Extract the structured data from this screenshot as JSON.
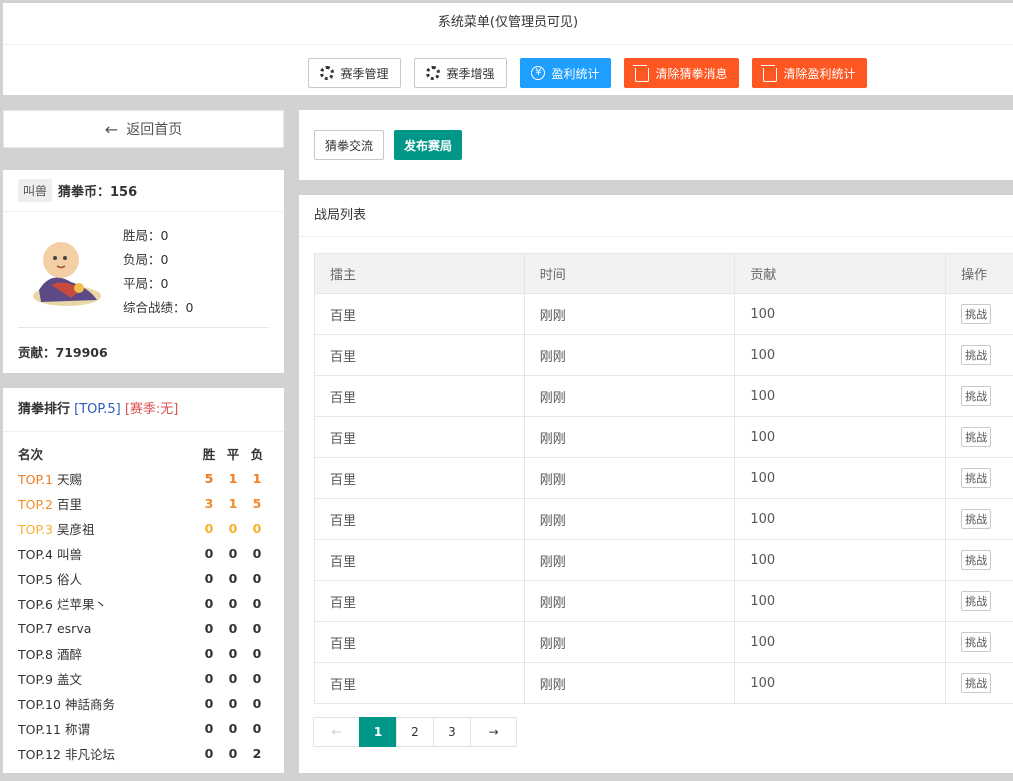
{
  "admin_menu": {
    "title": "系统菜单(仅管理员可见)",
    "buttons": [
      {
        "label": "赛季管理",
        "icon": "gear-icon"
      },
      {
        "label": "赛季增强",
        "icon": "gear-icon"
      },
      {
        "label": "盈利统计",
        "icon": "yen-icon"
      },
      {
        "label": "清除猜拳消息",
        "icon": "trash-icon"
      },
      {
        "label": "清除盈利统计",
        "icon": "trash-icon"
      }
    ]
  },
  "back_home": {
    "label": "返回首页",
    "icon": "arrow-left-icon"
  },
  "user": {
    "tag": "叫兽",
    "coin_label": "猜拳币：156",
    "wins": "胜局：0",
    "losses": "负局：0",
    "draws": "平局：0",
    "overall": "综合战绩：0",
    "contribution": "贡献：719906"
  },
  "ranking": {
    "title": "猜拳排行",
    "top_label": "[TOP.5]",
    "season_label": "[赛季:无]",
    "header": {
      "name": "名次",
      "win": "胜",
      "draw": "平",
      "loss": "负"
    },
    "rows": [
      {
        "rank": "TOP.1",
        "name": "天赐",
        "win": "5",
        "draw": "1",
        "loss": "1"
      },
      {
        "rank": "TOP.2",
        "name": "百里",
        "win": "3",
        "draw": "1",
        "loss": "5"
      },
      {
        "rank": "TOP.3",
        "name": "吴彦祖",
        "win": "0",
        "draw": "0",
        "loss": "0"
      },
      {
        "rank": "TOP.4",
        "name": "叫兽",
        "win": "0",
        "draw": "0",
        "loss": "0"
      },
      {
        "rank": "TOP.5",
        "name": "俗人",
        "win": "0",
        "draw": "0",
        "loss": "0"
      },
      {
        "rank": "TOP.6",
        "name": "烂苹果丶",
        "win": "0",
        "draw": "0",
        "loss": "0"
      },
      {
        "rank": "TOP.7",
        "name": "esrva",
        "win": "0",
        "draw": "0",
        "loss": "0"
      },
      {
        "rank": "TOP.8",
        "name": "酒醉",
        "win": "0",
        "draw": "0",
        "loss": "0"
      },
      {
        "rank": "TOP.9",
        "name": "盖文",
        "win": "0",
        "draw": "0",
        "loss": "0"
      },
      {
        "rank": "TOP.10",
        "name": "神話商务",
        "win": "0",
        "draw": "0",
        "loss": "0"
      },
      {
        "rank": "TOP.11",
        "name": "称谓",
        "win": "0",
        "draw": "0",
        "loss": "0"
      },
      {
        "rank": "TOP.12",
        "name": "非凡论坛",
        "win": "0",
        "draw": "0",
        "loss": "2"
      }
    ]
  },
  "actions": {
    "exchange_label": "猜拳交流",
    "publish_label": "发布赛局"
  },
  "battle_list": {
    "title": "战局列表",
    "columns": [
      "擂主",
      "时间",
      "贡献",
      "操作"
    ],
    "rows": [
      {
        "host": "百里",
        "time": "刚刚",
        "contrib": "100",
        "action": "挑战"
      },
      {
        "host": "百里",
        "time": "刚刚",
        "contrib": "100",
        "action": "挑战"
      },
      {
        "host": "百里",
        "time": "刚刚",
        "contrib": "100",
        "action": "挑战"
      },
      {
        "host": "百里",
        "time": "刚刚",
        "contrib": "100",
        "action": "挑战"
      },
      {
        "host": "百里",
        "time": "刚刚",
        "contrib": "100",
        "action": "挑战"
      },
      {
        "host": "百里",
        "time": "刚刚",
        "contrib": "100",
        "action": "挑战"
      },
      {
        "host": "百里",
        "time": "刚刚",
        "contrib": "100",
        "action": "挑战"
      },
      {
        "host": "百里",
        "time": "刚刚",
        "contrib": "100",
        "action": "挑战"
      },
      {
        "host": "百里",
        "time": "刚刚",
        "contrib": "100",
        "action": "挑战"
      },
      {
        "host": "百里",
        "time": "刚刚",
        "contrib": "100",
        "action": "挑战"
      }
    ]
  },
  "pagination": {
    "prev": "←",
    "pages": [
      "1",
      "2",
      "3"
    ],
    "current": "1",
    "next": "→"
  }
}
